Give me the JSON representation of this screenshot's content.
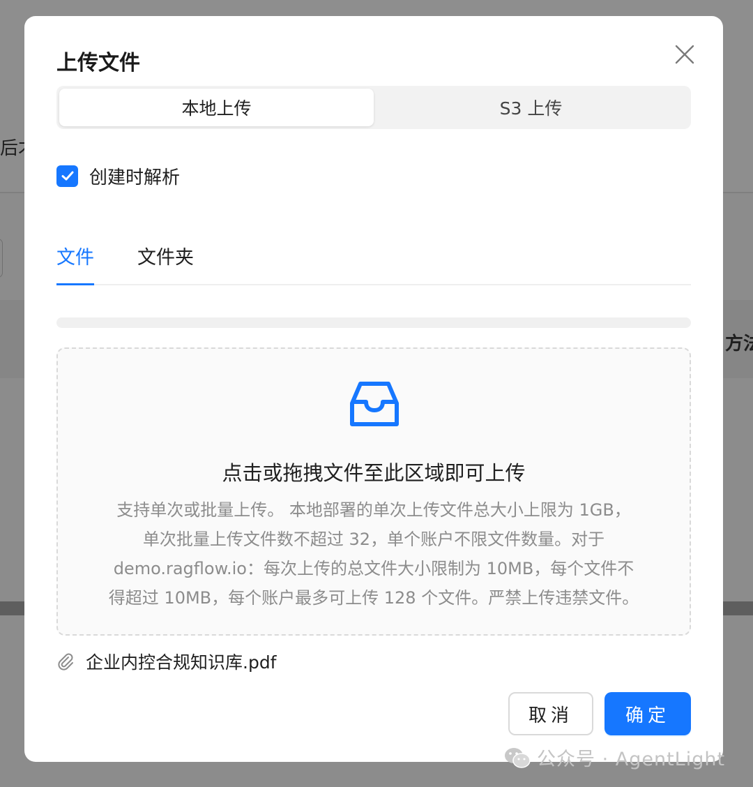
{
  "background": {
    "fragment_left": "后才",
    "fragment_right": "方法"
  },
  "modal": {
    "title": "上传文件",
    "close_icon": "close-icon",
    "segmented": {
      "options": [
        "本地上传",
        "S3 上传"
      ],
      "selected": "本地上传"
    },
    "parse_on_create": {
      "label": "创建时解析",
      "checked": true
    },
    "tabs": [
      "文件",
      "文件夹"
    ],
    "active_tab": "文件",
    "progress_percent": 0,
    "dropzone": {
      "icon": "inbox-icon",
      "title": "点击或拖拽文件至此区域即可上传",
      "hint_lines": [
        "支持单次或批量上传。 本地部署的单次上传文件总大小上限为 1GB，",
        "单次批量上传文件数不超过 32，单个账户不限文件数量。对于",
        "demo.ragflow.io：每次上传的总文件大小限制为 10MB，每个文件不",
        "得超过 10MB，每个账户最多可上传 128 个文件。严禁上传违禁文件。"
      ]
    },
    "file_list": [
      {
        "icon": "paperclip-icon",
        "name": "企业内控合规知识库.pdf"
      }
    ],
    "buttons": {
      "cancel": "取消",
      "ok": "确定"
    }
  },
  "watermark": {
    "icon": "wechat-icon",
    "text": "公众号 · AgentLight"
  },
  "colors": {
    "primary": "#1677ff",
    "overlay": "#8c8c8c",
    "hint_text": "#8c8c8c"
  }
}
